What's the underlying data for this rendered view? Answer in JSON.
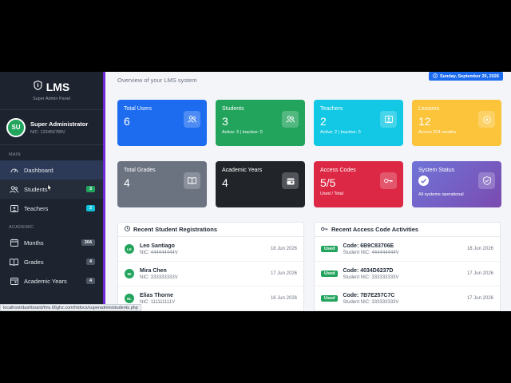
{
  "brand": {
    "title": "LMS",
    "subtitle": "Super Admin Panel"
  },
  "user": {
    "initials": "SU",
    "name": "Super Administrator",
    "nic": "NIC: 123456789V"
  },
  "nav": {
    "main_section": "MAIN",
    "academic_section": "ACADEMIC",
    "dashboard": "Dashboard",
    "students": {
      "label": "Students",
      "badge": "3"
    },
    "teachers": {
      "label": "Teachers",
      "badge": "2"
    },
    "months": {
      "label": "Months",
      "badge": "204"
    },
    "grades": {
      "label": "Grades",
      "badge": "4"
    },
    "academic_years": {
      "label": "Academic Years",
      "badge": "4"
    }
  },
  "header": {
    "subtitle": "Overview of your LMS system",
    "date": "Sunday, September 20, 2026"
  },
  "cards": {
    "total_users": {
      "title": "Total Users",
      "value": "6"
    },
    "students": {
      "title": "Students",
      "value": "3",
      "sub": "Active: 3 | Inactive: 0"
    },
    "teachers": {
      "title": "Teachers",
      "value": "2",
      "sub": "Active: 2 | Inactive: 0"
    },
    "lessons": {
      "title": "Lessons",
      "value": "12",
      "sub": "Across 204 months"
    },
    "total_grades": {
      "title": "Total Grades",
      "value": "4"
    },
    "academic_years": {
      "title": "Academic Years",
      "value": "4"
    },
    "access_codes": {
      "title": "Access Codes",
      "value": "5/5",
      "sub": "Used / Total"
    },
    "system_status": {
      "title": "System Status",
      "sub": "All systems operational"
    }
  },
  "recent_students": {
    "title": "Recent Student Registrations",
    "rows": [
      {
        "initials": "LE",
        "name": "Leo Santiago",
        "nic": "NIC: 444444444V",
        "date": "18 Jun 2026"
      },
      {
        "initials": "MI",
        "name": "Mira Chen",
        "nic": "NIC: 333333333V",
        "date": "17 Jun 2026"
      },
      {
        "initials": "EL",
        "name": "Elias Thorne",
        "nic": "NIC: 111111111V",
        "date": "16 Jun 2026"
      }
    ]
  },
  "recent_codes": {
    "title": "Recent Access Code Activities",
    "rows": [
      {
        "status": "Used",
        "code": "Code: 6B9C83706E",
        "student": "Student NIC: 444444444V",
        "date": "18 Jun 2026"
      },
      {
        "status": "Used",
        "code": "Code: 4034D6237D",
        "student": "Student NIC: 333333333V",
        "date": "17 Jun 2026"
      },
      {
        "status": "Used",
        "code": "Code: 7B7E257C7C",
        "student": "Student NIC: 333333333V",
        "date": "17 Jun 2026"
      }
    ]
  },
  "status_url": "localhost/dashboard/lms.66ghz.com/htdocs/superadmin/students.php",
  "colors": {
    "primary": "#1d6cf0",
    "success": "#22a45d",
    "info": "#12c8e4",
    "warning": "#fbc43a",
    "danger": "#dc2845",
    "sidebar": "#1d2430",
    "accent": "#6d28d9"
  }
}
